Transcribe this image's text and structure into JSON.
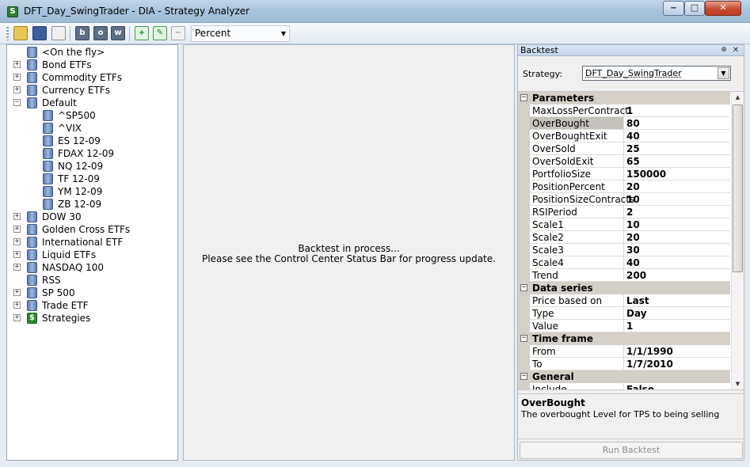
{
  "window": {
    "title": "DFT_Day_SwingTrader - DIA - Strategy Analyzer",
    "min_glyph": "‒",
    "max_glyph": "□",
    "close_glyph": "✕",
    "app_icon_glyph": "S"
  },
  "toolbar": {
    "b_label": "b",
    "o_label": "o",
    "w_label": "w",
    "add_glyph": "+",
    "edit_glyph": "✎",
    "remove_glyph": "−",
    "display_unit": "Percent",
    "display_unit_arrow": "▼"
  },
  "tree": {
    "items": [
      {
        "label": "<On the fly>",
        "expander": ""
      },
      {
        "label": "Bond ETFs",
        "expander": "+"
      },
      {
        "label": "Commodity ETFs",
        "expander": "+"
      },
      {
        "label": "Currency ETFs",
        "expander": "+"
      },
      {
        "label": "Default",
        "expander": "−"
      },
      {
        "label": "^SP500",
        "expander": ""
      },
      {
        "label": "^VIX",
        "expander": ""
      },
      {
        "label": "ES 12-09",
        "expander": ""
      },
      {
        "label": "FDAX 12-09",
        "expander": ""
      },
      {
        "label": "NQ 12-09",
        "expander": ""
      },
      {
        "label": "TF 12-09",
        "expander": ""
      },
      {
        "label": "YM 12-09",
        "expander": ""
      },
      {
        "label": "ZB 12-09",
        "expander": ""
      },
      {
        "label": "DOW 30",
        "expander": "+"
      },
      {
        "label": "Golden Cross ETFs",
        "expander": "+"
      },
      {
        "label": "International ETF",
        "expander": "+"
      },
      {
        "label": "Liquid ETFs",
        "expander": "+"
      },
      {
        "label": "NASDAQ 100",
        "expander": "+"
      },
      {
        "label": "RSS",
        "expander": ""
      },
      {
        "label": "SP 500",
        "expander": "+"
      },
      {
        "label": "Trade ETF",
        "expander": "+"
      },
      {
        "label": "Strategies",
        "expander": "+",
        "icon_glyph": "$"
      }
    ]
  },
  "center": {
    "line1": "Backtest in process...",
    "line2": "Please see the Control Center Status Bar for progress update."
  },
  "backtest_panel": {
    "title": "Backtest",
    "pin_glyph": "⊕",
    "close_glyph": "✕",
    "strategy_label": "Strategy:",
    "strategy_value": "DFT_Day_SwingTrader",
    "strategy_arrow": "▼",
    "scroll_up": "▲",
    "scroll_down": "▼",
    "grid": [
      {
        "kind": "cat",
        "name": "Parameters",
        "expander": "−"
      },
      {
        "kind": "prop",
        "name": "MaxLossPerContract",
        "value": "1"
      },
      {
        "kind": "prop",
        "name": "OverBought",
        "value": "80",
        "selected": true
      },
      {
        "kind": "prop",
        "name": "OverBoughtExit",
        "value": "40"
      },
      {
        "kind": "prop",
        "name": "OverSold",
        "value": "25"
      },
      {
        "kind": "prop",
        "name": "OverSoldExit",
        "value": "65"
      },
      {
        "kind": "prop",
        "name": "PortfolioSize",
        "value": "150000"
      },
      {
        "kind": "prop",
        "name": "PositionPercent",
        "value": "20"
      },
      {
        "kind": "prop",
        "name": "PositionSizeContracts",
        "value": "10"
      },
      {
        "kind": "prop",
        "name": "RSIPeriod",
        "value": "2"
      },
      {
        "kind": "prop",
        "name": "Scale1",
        "value": "10"
      },
      {
        "kind": "prop",
        "name": "Scale2",
        "value": "20"
      },
      {
        "kind": "prop",
        "name": "Scale3",
        "value": "30"
      },
      {
        "kind": "prop",
        "name": "Scale4",
        "value": "40"
      },
      {
        "kind": "prop",
        "name": "Trend",
        "value": "200"
      },
      {
        "kind": "cat",
        "name": "Data series",
        "expander": "−"
      },
      {
        "kind": "prop",
        "name": "Price based on",
        "value": "Last"
      },
      {
        "kind": "prop",
        "name": "Type",
        "value": "Day"
      },
      {
        "kind": "prop",
        "name": "Value",
        "value": "1"
      },
      {
        "kind": "cat",
        "name": "Time frame",
        "expander": "−"
      },
      {
        "kind": "prop",
        "name": "From",
        "value": "1/1/1990"
      },
      {
        "kind": "prop",
        "name": "To",
        "value": "1/7/2010"
      },
      {
        "kind": "cat",
        "name": "General",
        "expander": "−"
      },
      {
        "kind": "prop",
        "name": "Include commission",
        "value": "False"
      }
    ],
    "description": {
      "title": "OverBought",
      "text": "The overbought Level for TPS to being selling"
    },
    "run_button": "Run Backtest"
  }
}
